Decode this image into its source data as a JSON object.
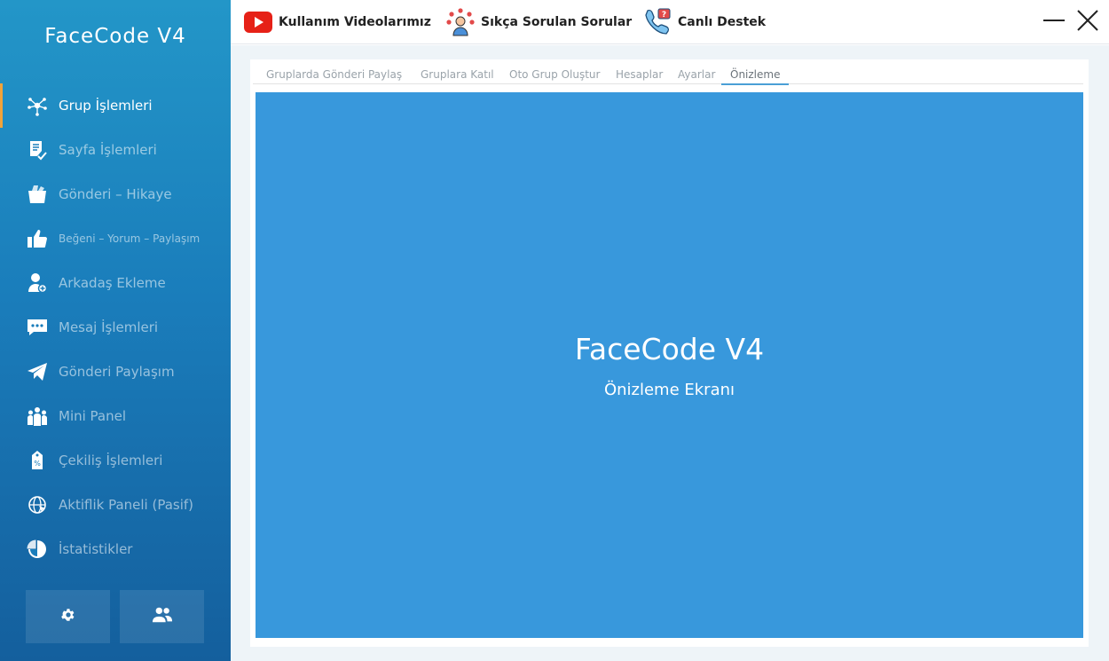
{
  "app": {
    "title": "FaceCode V4"
  },
  "sidebar": {
    "items": [
      {
        "label": "Grup İşlemleri",
        "icon": "network-icon",
        "active": true
      },
      {
        "label": "Sayfa İşlemleri",
        "icon": "document-icon"
      },
      {
        "label": "Gönderi – Hikaye",
        "icon": "folder-icon"
      },
      {
        "label": "Beğeni – Yorum – Paylaşım",
        "icon": "thumbs-up-icon"
      },
      {
        "label": "Arkadaş Ekleme",
        "icon": "add-user-icon"
      },
      {
        "label": "Mesaj İşlemleri",
        "icon": "chat-icon"
      },
      {
        "label": "Gönderi Paylaşım",
        "icon": "send-icon"
      },
      {
        "label": "Mini Panel",
        "icon": "group-icon"
      },
      {
        "label": "Çekiliş İşlemleri",
        "icon": "ticket-icon"
      },
      {
        "label": "Aktiflik Paneli (Pasif)",
        "icon": "globe-cursor-icon"
      },
      {
        "label": "İstatistikler",
        "icon": "pie-chart-icon"
      }
    ],
    "buttons": [
      {
        "icon": "gear-icon"
      },
      {
        "icon": "users-icon"
      }
    ]
  },
  "topbar": {
    "links": [
      {
        "label": "Kullanım Videolarımız",
        "icon": "youtube-icon"
      },
      {
        "label": "Sıkça Sorulan Sorular",
        "icon": "faq-person-icon"
      },
      {
        "label": "Canlı Destek",
        "icon": "phone-support-icon"
      }
    ]
  },
  "tabs": [
    {
      "label": "Gruplarda Gönderi Paylaş"
    },
    {
      "label": "Gruplara Katıl"
    },
    {
      "label": "Oto Grup Oluştur"
    },
    {
      "label": "Hesaplar"
    },
    {
      "label": "Ayarlar"
    },
    {
      "label": "Önizleme",
      "active": true
    }
  ],
  "preview": {
    "title": "FaceCode V4",
    "subtitle": "Önizleme Ekranı"
  },
  "colors": {
    "sidebar_top": "#2396c8",
    "sidebar_bottom": "#145f9d",
    "active_indicator": "#f1a33a",
    "preview_bg": "#3898dc",
    "tab_active_underline": "#4a9fd6",
    "youtube_red": "#e62117"
  }
}
